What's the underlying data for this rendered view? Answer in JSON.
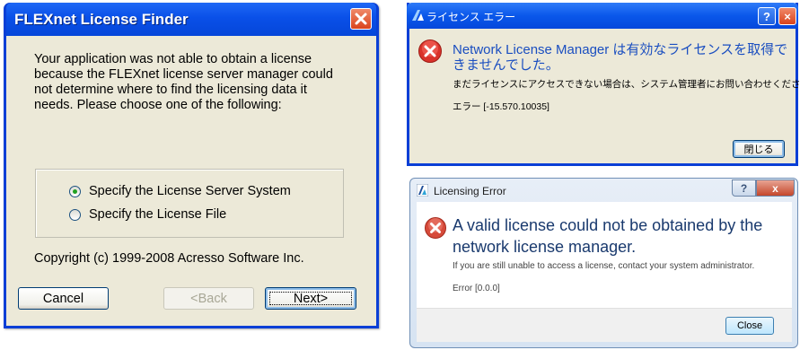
{
  "dialog_flexnet": {
    "title": "FLEXnet License Finder",
    "message": "Your application was not able to obtain a license because the FLEXnet license server manager could not determine where to find the licensing data it needs.  Please choose one of the following:",
    "options": [
      {
        "label": "Specify the License Server System",
        "selected": true
      },
      {
        "label": "Specify the License File",
        "selected": false
      }
    ],
    "copyright": "Copyright (c) 1999-2008 Acresso Software Inc.",
    "buttons": {
      "cancel": "Cancel",
      "back": "<Back",
      "next": "Next>"
    },
    "title_bar_color": "#0a50e8"
  },
  "dialog_jp": {
    "title": "ライセンス エラー",
    "message": "Network License Manager は有効なライセンスを取得できませんでした。",
    "detail": "まだライセンスにアクセスできない場合は、システム管理者にお問い合わせください。",
    "error_code": "エラー [-15.570.10035]",
    "close_button": "閉じる",
    "title_buttons": {
      "help": "?",
      "close": "×"
    },
    "message_color": "#1a4ec0"
  },
  "dialog_licensing": {
    "title": "Licensing Error",
    "message": "A valid license could not be obtained by the network license manager.",
    "detail": "If you are still unable to access a license, contact your system administrator.",
    "error_code": "Error [0.0.0]",
    "close_button": "Close",
    "title_buttons": {
      "help": "?",
      "close": "x"
    },
    "message_color": "#1a3a6e"
  },
  "icons": {
    "error": "error-x-circle-icon",
    "app": "autodesk-a-icon"
  }
}
